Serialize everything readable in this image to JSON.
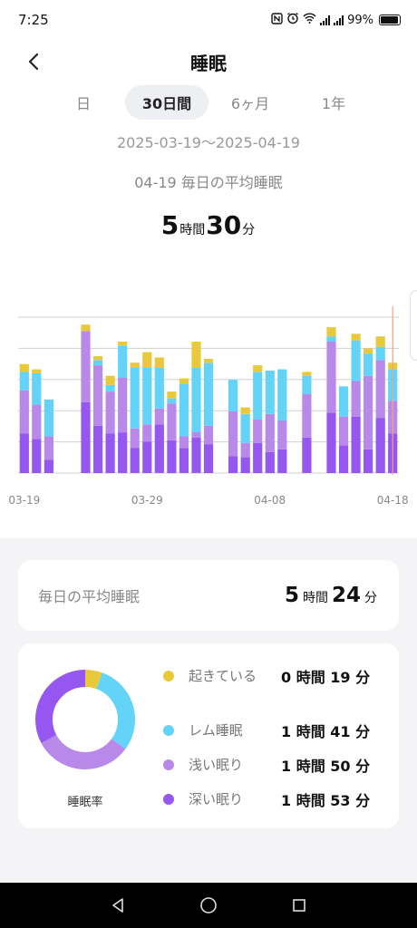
{
  "status_bar": {
    "time": "7:25",
    "battery_percent": "99%",
    "icons": [
      "nfc-icon",
      "alarm-icon",
      "wifi-icon",
      "signal-icon",
      "battery-icon"
    ]
  },
  "header": {
    "title": "睡眠",
    "back_icon": "chevron-left-icon"
  },
  "tabs": [
    {
      "label": "日",
      "active": false
    },
    {
      "label": "30日間",
      "active": true
    },
    {
      "label": "6ヶ月",
      "active": false
    },
    {
      "label": "1年",
      "active": false
    }
  ],
  "date_range": "2025-03-19～2025-04-19",
  "summary": {
    "label": "04-19  毎日の平均睡眠",
    "hours": "5",
    "hours_unit": "時間",
    "minutes": "30",
    "minutes_unit": "分"
  },
  "colors": {
    "awake": "#e8c93c",
    "rem": "#63d3f7",
    "light": "#b889e8",
    "deep": "#9656f0",
    "highlight": "#f2a37a"
  },
  "chart_data": {
    "type": "bar",
    "stacked": true,
    "x_tick_labels": [
      "03-19",
      "03-29",
      "04-08",
      "04-18"
    ],
    "grid": true,
    "series_order": [
      "deep",
      "light",
      "rem",
      "awake"
    ],
    "y_max_minutes": 600,
    "bars": [
      {
        "day": 0,
        "deep": 150,
        "light": 165,
        "rem": 70,
        "awake": 30
      },
      {
        "day": 1,
        "deep": 130,
        "light": 130,
        "rem": 120,
        "awake": 15
      },
      {
        "day": 2,
        "deep": 50,
        "light": 90,
        "rem": 140,
        "awake": 0
      },
      {
        "day": 3,
        "deep": 0,
        "light": 0,
        "rem": 0,
        "awake": 0
      },
      {
        "day": 4,
        "deep": 0,
        "light": 0,
        "rem": 0,
        "awake": 0
      },
      {
        "day": 5,
        "deep": 270,
        "light": 270,
        "rem": 0,
        "awake": 25
      },
      {
        "day": 6,
        "deep": 180,
        "light": 230,
        "rem": 20,
        "awake": 15
      },
      {
        "day": 7,
        "deep": 150,
        "light": 160,
        "rem": 25,
        "awake": 35
      },
      {
        "day": 8,
        "deep": 155,
        "light": 210,
        "rem": 120,
        "awake": 15
      },
      {
        "day": 9,
        "deep": 95,
        "light": 75,
        "rem": 230,
        "awake": 20
      },
      {
        "day": 10,
        "deep": 120,
        "light": 65,
        "rem": 215,
        "awake": 60
      },
      {
        "day": 11,
        "deep": 185,
        "light": 60,
        "rem": 155,
        "awake": 40
      },
      {
        "day": 12,
        "deep": 125,
        "light": 140,
        "rem": 20,
        "awake": 25
      },
      {
        "day": 13,
        "deep": 95,
        "light": 45,
        "rem": 200,
        "awake": 20
      },
      {
        "day": 14,
        "deep": 135,
        "light": 20,
        "rem": 245,
        "awake": 100
      },
      {
        "day": 15,
        "deep": 110,
        "light": 70,
        "rem": 240,
        "awake": 15
      },
      {
        "day": 16,
        "deep": 0,
        "light": 0,
        "rem": 0,
        "awake": 0
      },
      {
        "day": 17,
        "deep": 65,
        "light": 170,
        "rem": 120,
        "awake": 0
      },
      {
        "day": 18,
        "deep": 60,
        "light": 55,
        "rem": 110,
        "awake": 25
      },
      {
        "day": 19,
        "deep": 115,
        "light": 90,
        "rem": 180,
        "awake": 25
      },
      {
        "day": 20,
        "deep": 80,
        "light": 145,
        "rem": 165,
        "awake": 0
      },
      {
        "day": 21,
        "deep": 90,
        "light": 110,
        "rem": 195,
        "awake": 0
      },
      {
        "day": 22,
        "deep": 0,
        "light": 0,
        "rem": 0,
        "awake": 0
      },
      {
        "day": 23,
        "deep": 135,
        "light": 165,
        "rem": 70,
        "awake": 15
      },
      {
        "day": 24,
        "deep": 0,
        "light": 0,
        "rem": 0,
        "awake": 0
      },
      {
        "day": 25,
        "deep": 230,
        "light": 270,
        "rem": 20,
        "awake": 35
      },
      {
        "day": 26,
        "deep": 105,
        "light": 110,
        "rem": 115,
        "awake": 0
      },
      {
        "day": 27,
        "deep": 215,
        "light": 135,
        "rem": 155,
        "awake": 25
      },
      {
        "day": 28,
        "deep": 90,
        "light": 280,
        "rem": 85,
        "awake": 20
      },
      {
        "day": 29,
        "deep": 210,
        "light": 220,
        "rem": 50,
        "awake": 40
      },
      {
        "day": 30,
        "deep": 150,
        "light": 125,
        "rem": 120,
        "awake": 25
      }
    ]
  },
  "average_card": {
    "label": "毎日の平均睡眠",
    "hours": "5",
    "hours_unit": "時間",
    "minutes": "24",
    "minutes_unit": "分"
  },
  "breakdown": {
    "caption": "睡眠率",
    "items": [
      {
        "key": "awake",
        "label": "起きている",
        "value": "0 時間 19 分",
        "minutes": 19
      },
      {
        "key": "rem",
        "label": "レム睡眠",
        "value": "1 時間 41 分",
        "minutes": 101
      },
      {
        "key": "light",
        "label": "浅い眠り",
        "value": "1 時間 50 分",
        "minutes": 110
      },
      {
        "key": "deep",
        "label": "深い眠り",
        "value": "1 時間 53 分",
        "minutes": 113
      }
    ]
  },
  "nav": {
    "icons": [
      "back-triangle-icon",
      "home-circle-icon",
      "recents-square-icon"
    ]
  }
}
